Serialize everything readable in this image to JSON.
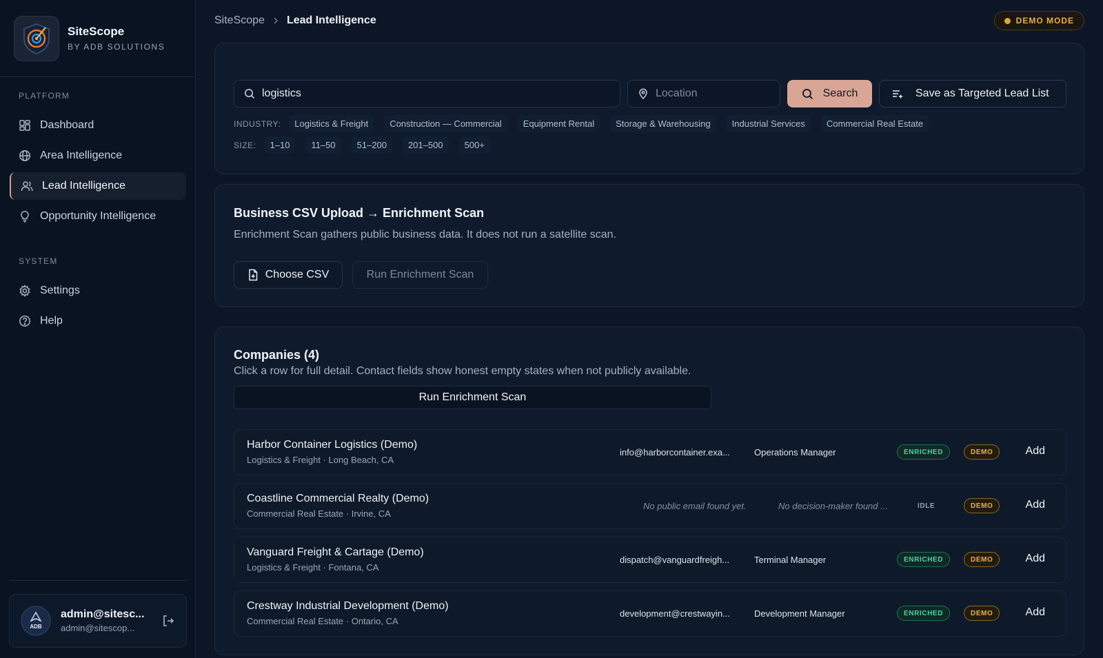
{
  "brand": {
    "name": "SiteScope",
    "subtitle": "BY ADB SOLUTIONS"
  },
  "sidebar": {
    "platform_label": "PLATFORM",
    "system_label": "SYSTEM",
    "platform_items": [
      {
        "label": "Dashboard",
        "icon": "grid-icon"
      },
      {
        "label": "Area Intelligence",
        "icon": "globe-icon"
      },
      {
        "label": "Lead Intelligence",
        "icon": "users-icon",
        "active": true
      },
      {
        "label": "Opportunity Intelligence",
        "icon": "lightbulb-icon"
      }
    ],
    "system_items": [
      {
        "label": "Settings",
        "icon": "gear-icon"
      },
      {
        "label": "Help",
        "icon": "help-circle-icon"
      }
    ]
  },
  "user": {
    "name": "admin@sitesc...",
    "email": "admin@sitescop...",
    "avatar_text": "ADB"
  },
  "header": {
    "breadcrumb_root": "SiteScope",
    "breadcrumb_current": "Lead Intelligence",
    "demo_mode": "DEMO MODE"
  },
  "search": {
    "query": "logistics",
    "location_placeholder": "Location",
    "search_label": "Search",
    "save_list_label": "Save as Targeted Lead List",
    "industry_label": "INDUSTRY:",
    "industries": [
      "Logistics & Freight",
      "Construction — Commercial",
      "Equipment Rental",
      "Storage & Warehousing",
      "Industrial Services",
      "Commercial Real Estate"
    ],
    "size_label": "SIZE:",
    "sizes": [
      "1–10",
      "11–50",
      "51–200",
      "201–500",
      "500+"
    ]
  },
  "csv": {
    "title": "Business CSV Upload → Enrichment Scan",
    "description": "Enrichment Scan gathers public business data. It does not run a satellite scan.",
    "choose_label": "Choose CSV",
    "run_label": "Run Enrichment Scan"
  },
  "companies": {
    "title": "Companies (4)",
    "description": "Click a row for full detail. Contact fields show honest empty states when not publicly available.",
    "run_label": "Run Enrichment Scan",
    "add_label": "Add",
    "rows": [
      {
        "name": "Harbor Container Logistics (Demo)",
        "meta": "Logistics & Freight · Long Beach, CA",
        "email": "info@harborcontainer.exa...",
        "role": "Operations Manager",
        "status": "ENRICHED",
        "tag": "DEMO"
      },
      {
        "name": "Coastline Commercial Realty (Demo)",
        "meta": "Commercial Real Estate · Irvine, CA",
        "email": "No public email found yet.",
        "role": "No decision-maker found ...",
        "status": "IDLE",
        "tag": "DEMO"
      },
      {
        "name": "Vanguard Freight & Cartage (Demo)",
        "meta": "Logistics & Freight · Fontana, CA",
        "email": "dispatch@vanguardfreigh...",
        "role": "Terminal Manager",
        "status": "ENRICHED",
        "tag": "DEMO"
      },
      {
        "name": "Crestway Industrial Development (Demo)",
        "meta": "Commercial Real Estate · Ontario, CA",
        "email": "development@crestwayin...",
        "role": "Development Manager",
        "status": "ENRICHED",
        "tag": "DEMO"
      }
    ]
  },
  "colors": {
    "accent": "#d9a696",
    "enriched": "#4fd1a4",
    "demo": "#e3b34c",
    "background": "#0c1626"
  }
}
